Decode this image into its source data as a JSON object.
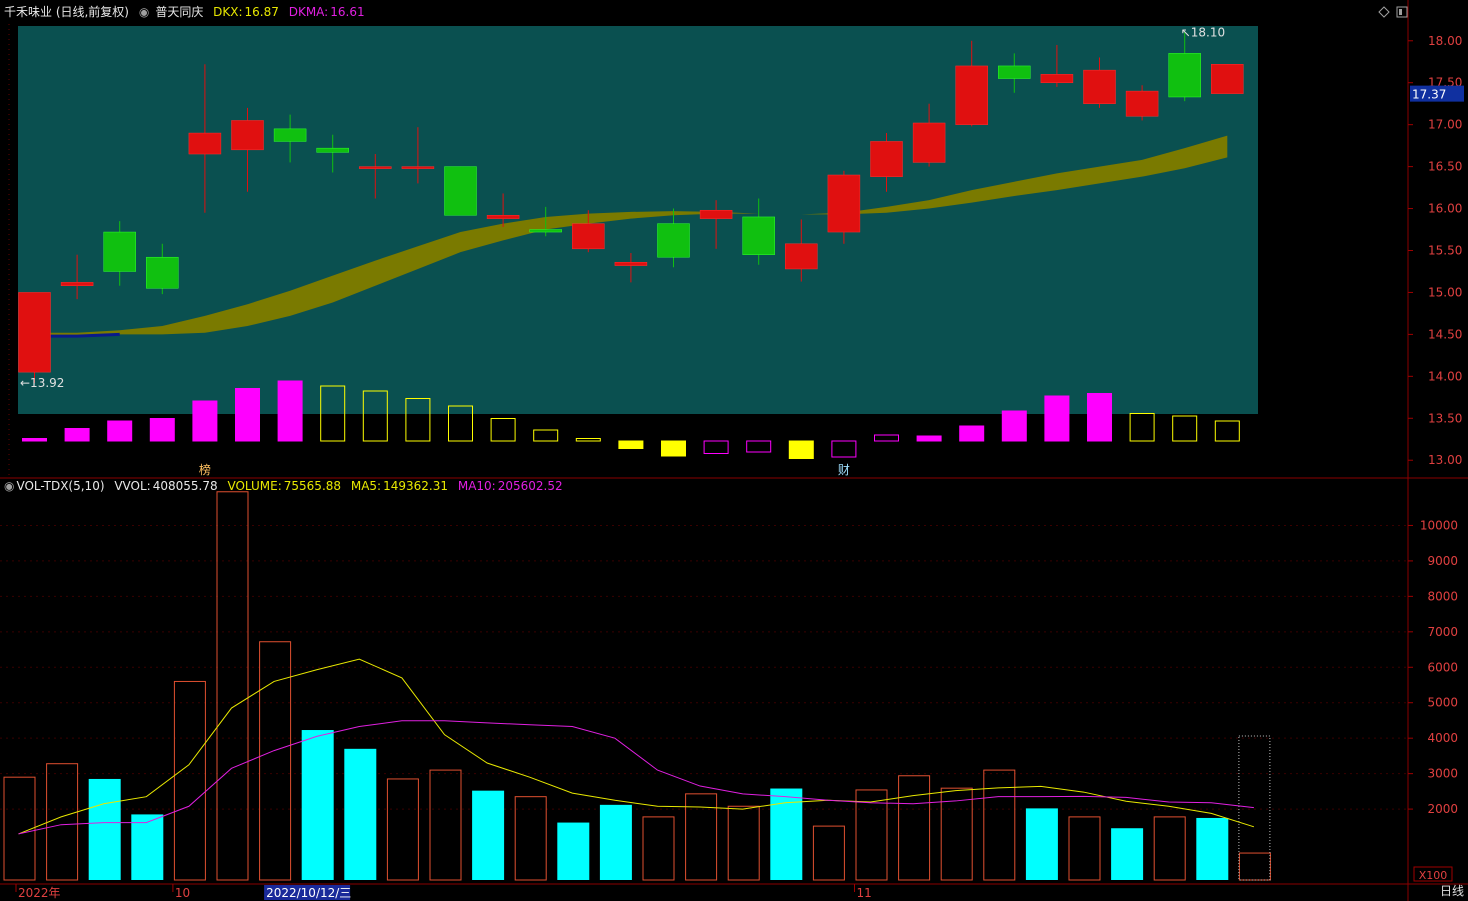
{
  "header": {
    "title": "千禾味业 (日线,前复权)",
    "indicator_name": "普天同庆",
    "dkx_label": "DKX:",
    "dkx_value": "16.87",
    "dkma_label": "DKMA:",
    "dkma_value": "16.61"
  },
  "price_panel": {
    "current_price_tag": "17.37",
    "high_marker": "18.10",
    "low_marker": "13.92",
    "event_marks": [
      {
        "index": 4,
        "text": "榜"
      },
      {
        "index": 19,
        "text": "财"
      }
    ]
  },
  "volume_header": {
    "indicator_name": "VOL-TDX(5,10)",
    "vvol_label": "VVOL:",
    "vvol_value": "408055.78",
    "volume_label": "VOLUME:",
    "volume_value": "75565.88",
    "ma5_label": "MA5:",
    "ma5_value": "149362.31",
    "ma10_label": "MA10:",
    "ma10_value": "205602.52"
  },
  "volume_panel": {
    "unit_label": "X100"
  },
  "x_axis": {
    "labels": [
      {
        "index": 0,
        "text": "2022年"
      },
      {
        "index": 4,
        "text": "10"
      },
      {
        "index": 6,
        "text": "2022/10/12/三",
        "highlight": true
      },
      {
        "index": 20,
        "text": "11"
      }
    ]
  },
  "period_label": "日线",
  "colors": {
    "up": "#e01010",
    "down": "#10c010",
    "band_fill": "#7a7a00",
    "band_low": "#0a1a8a",
    "panel_bg": "#0a5050",
    "volume_up": "#e05030",
    "volume_down": "#00ffff",
    "ma5": "#e8e800",
    "ma10": "#e020e0",
    "axis_text": "#e04040",
    "grid": "#5a0000"
  },
  "chart_data": [
    {
      "type": "candlestick",
      "title": "千禾味业 (日线,前复权)",
      "ylim": [
        12.8,
        18.2
      ],
      "y_ticks": [
        "18.00",
        "17.50",
        "17.00",
        "16.50",
        "16.00",
        "15.50",
        "15.00",
        "14.50",
        "14.00",
        "13.50",
        "13.00"
      ],
      "candles": [
        {
          "o": 14.05,
          "h": 14.15,
          "l": 13.92,
          "c": 15.0
        },
        {
          "o": 15.08,
          "h": 15.45,
          "l": 14.92,
          "c": 15.12
        },
        {
          "o": 15.25,
          "h": 15.85,
          "l": 15.08,
          "c": 15.72
        },
        {
          "o": 15.05,
          "h": 15.58,
          "l": 14.98,
          "c": 15.42
        },
        {
          "o": 16.65,
          "h": 17.72,
          "l": 15.95,
          "c": 16.9
        },
        {
          "o": 16.7,
          "h": 17.2,
          "l": 16.2,
          "c": 17.05
        },
        {
          "o": 16.95,
          "h": 17.12,
          "l": 16.55,
          "c": 16.8
        },
        {
          "o": 16.72,
          "h": 16.88,
          "l": 16.43,
          "c": 16.67
        },
        {
          "o": 16.48,
          "h": 16.65,
          "l": 16.12,
          "c": 16.5
        },
        {
          "o": 16.48,
          "h": 16.97,
          "l": 16.3,
          "c": 16.5
        },
        {
          "o": 16.5,
          "h": 16.5,
          "l": 15.92,
          "c": 15.92
        },
        {
          "o": 15.88,
          "h": 16.18,
          "l": 15.78,
          "c": 15.92
        },
        {
          "o": 15.75,
          "h": 16.02,
          "l": 15.67,
          "c": 15.72
        },
        {
          "o": 15.82,
          "h": 15.98,
          "l": 15.48,
          "c": 15.52
        },
        {
          "o": 15.32,
          "h": 15.47,
          "l": 15.12,
          "c": 15.36
        },
        {
          "o": 15.42,
          "h": 16.0,
          "l": 15.3,
          "c": 15.82
        },
        {
          "o": 15.88,
          "h": 16.1,
          "l": 15.52,
          "c": 15.98
        },
        {
          "o": 15.9,
          "h": 16.12,
          "l": 15.33,
          "c": 15.45
        },
        {
          "o": 15.28,
          "h": 15.87,
          "l": 15.13,
          "c": 15.58
        },
        {
          "o": 15.72,
          "h": 16.45,
          "l": 15.58,
          "c": 16.4
        },
        {
          "o": 16.38,
          "h": 16.9,
          "l": 16.2,
          "c": 16.8
        },
        {
          "o": 16.55,
          "h": 17.25,
          "l": 16.5,
          "c": 17.02
        },
        {
          "o": 17.0,
          "h": 18.0,
          "l": 16.98,
          "c": 17.7
        },
        {
          "o": 17.7,
          "h": 17.85,
          "l": 17.38,
          "c": 17.55
        },
        {
          "o": 17.5,
          "h": 17.95,
          "l": 17.45,
          "c": 17.6
        },
        {
          "o": 17.65,
          "h": 17.8,
          "l": 17.2,
          "c": 17.25
        },
        {
          "o": 17.1,
          "h": 17.47,
          "l": 17.05,
          "c": 17.4
        },
        {
          "o": 17.85,
          "h": 18.1,
          "l": 17.28,
          "c": 17.33
        },
        {
          "o": 17.37,
          "h": 17.72,
          "l": 17.37,
          "c": 17.72
        }
      ],
      "candle_colors": [
        "up",
        "up",
        "down",
        "down",
        "up",
        "up",
        "down",
        "down",
        "up",
        "up",
        "down",
        "up",
        "down",
        "up",
        "up",
        "down",
        "up",
        "down",
        "up",
        "up",
        "up",
        "up",
        "up",
        "down",
        "up",
        "up",
        "up",
        "down",
        "up"
      ],
      "band": {
        "upper": [
          14.52,
          14.52,
          14.55,
          14.6,
          14.72,
          14.86,
          15.02,
          15.2,
          15.38,
          15.55,
          15.72,
          15.82,
          15.9,
          15.94,
          15.96,
          15.97,
          15.96,
          15.94,
          15.93,
          15.95,
          16.02,
          16.1,
          16.22,
          16.32,
          16.42,
          16.5,
          16.58,
          16.72,
          16.87
        ],
        "lower": [
          14.48,
          14.48,
          14.5,
          14.5,
          14.52,
          14.6,
          14.72,
          14.88,
          15.08,
          15.28,
          15.48,
          15.62,
          15.75,
          15.82,
          15.88,
          15.92,
          15.94,
          15.94,
          15.93,
          15.93,
          15.95,
          16.0,
          16.07,
          16.15,
          16.22,
          16.3,
          16.38,
          16.48,
          16.61
        ]
      },
      "strength_bars": [
        {
          "v": 0.05,
          "solid": true,
          "color": "magenta"
        },
        {
          "v": 0.25,
          "solid": true,
          "color": "magenta"
        },
        {
          "v": 0.4,
          "solid": true,
          "color": "magenta"
        },
        {
          "v": 0.45,
          "solid": true,
          "color": "magenta"
        },
        {
          "v": 0.8,
          "solid": true,
          "color": "magenta"
        },
        {
          "v": 1.05,
          "solid": true,
          "color": "magenta"
        },
        {
          "v": 1.2,
          "solid": true,
          "color": "magenta"
        },
        {
          "v": 1.1,
          "solid": false,
          "color": "yellow"
        },
        {
          "v": 1.0,
          "solid": false,
          "color": "yellow"
        },
        {
          "v": 0.85,
          "solid": false,
          "color": "yellow"
        },
        {
          "v": 0.7,
          "solid": false,
          "color": "yellow"
        },
        {
          "v": 0.45,
          "solid": false,
          "color": "yellow"
        },
        {
          "v": 0.22,
          "solid": false,
          "color": "yellow"
        },
        {
          "v": 0.05,
          "solid": false,
          "color": "yellow"
        },
        {
          "v": -0.15,
          "solid": true,
          "color": "yellow"
        },
        {
          "v": -0.3,
          "solid": true,
          "color": "yellow"
        },
        {
          "v": -0.25,
          "solid": false,
          "color": "magenta"
        },
        {
          "v": -0.22,
          "solid": false,
          "color": "magenta"
        },
        {
          "v": -0.35,
          "solid": true,
          "color": "yellow"
        },
        {
          "v": -0.32,
          "solid": false,
          "color": "magenta"
        },
        {
          "v": 0.12,
          "solid": false,
          "color": "magenta"
        },
        {
          "v": 0.1,
          "solid": true,
          "color": "magenta"
        },
        {
          "v": 0.3,
          "solid": true,
          "color": "magenta"
        },
        {
          "v": 0.6,
          "solid": true,
          "color": "magenta"
        },
        {
          "v": 0.9,
          "solid": true,
          "color": "magenta"
        },
        {
          "v": 0.95,
          "solid": true,
          "color": "magenta"
        },
        {
          "v": 0.55,
          "solid": false,
          "color": "yellow"
        },
        {
          "v": 0.5,
          "solid": false,
          "color": "yellow"
        },
        {
          "v": 0.4,
          "solid": false,
          "color": "yellow"
        }
      ]
    },
    {
      "type": "bar",
      "title": "VOL-TDX(5,10)",
      "unit": "X100",
      "ylim": [
        0,
        11000
      ],
      "y_ticks": [
        2000,
        3000,
        4000,
        5000,
        6000,
        7000,
        8000,
        9000,
        10000
      ],
      "volumes": [
        2900,
        3280,
        2850,
        1850,
        5600,
        10950,
        6720,
        4230,
        3700,
        2850,
        3100,
        2520,
        2350,
        1620,
        2120,
        1780,
        2430,
        2080,
        2580,
        1520,
        2540,
        2940,
        2590,
        3100,
        2020,
        1780,
        1460,
        1780,
        1750,
        760
      ],
      "volume_styles": [
        "up",
        "up",
        "down",
        "down",
        "up",
        "up",
        "up",
        "down",
        "down",
        "up",
        "up",
        "down",
        "up",
        "down",
        "down",
        "up",
        "up",
        "up",
        "down",
        "up",
        "up",
        "up",
        "up",
        "up",
        "down",
        "up",
        "down",
        "up",
        "down",
        "up"
      ],
      "current_bar_estimate": 4060,
      "series": [
        {
          "name": "MA5",
          "values": [
            1300,
            1780,
            2150,
            2350,
            3250,
            4850,
            5600,
            5930,
            6230,
            5700,
            4100,
            3300,
            2900,
            2450,
            2250,
            2080,
            2060,
            2000,
            2180,
            2250,
            2200,
            2380,
            2520,
            2600,
            2640,
            2480,
            2220,
            2080,
            1880,
            1500
          ]
        },
        {
          "name": "MA10",
          "values": [
            1300,
            1560,
            1620,
            1620,
            2080,
            3150,
            3650,
            4050,
            4330,
            4490,
            4490,
            4430,
            4380,
            4330,
            4000,
            3100,
            2650,
            2430,
            2350,
            2250,
            2180,
            2150,
            2230,
            2350,
            2350,
            2360,
            2330,
            2200,
            2180,
            2040
          ]
        }
      ]
    }
  ]
}
